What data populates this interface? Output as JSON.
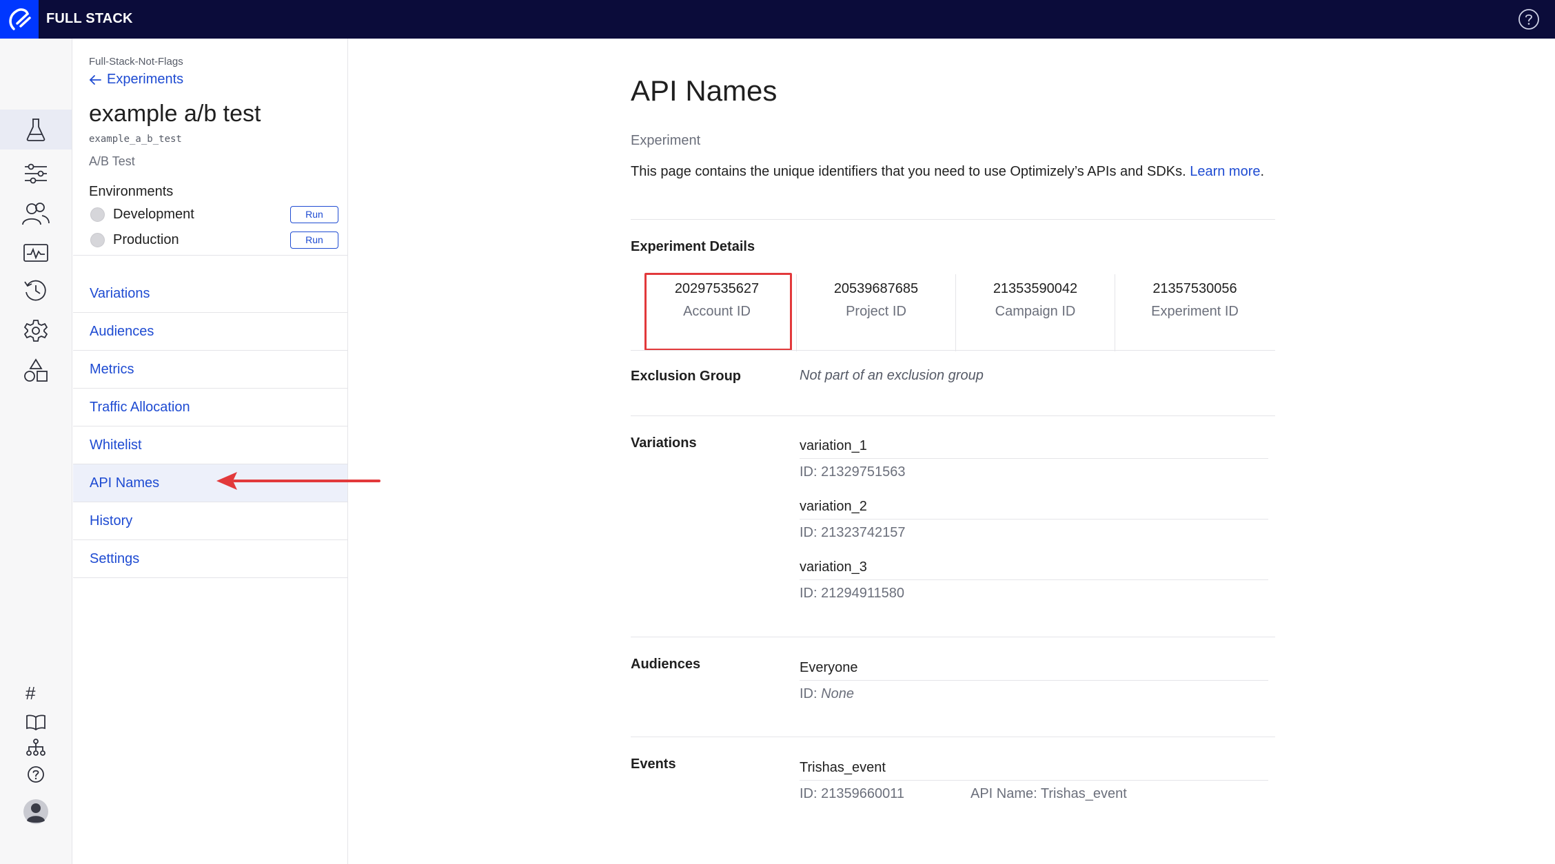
{
  "app": {
    "title": "FULL STACK"
  },
  "sidebar": {
    "project": "Full-Stack-Not-Flags",
    "back_label": "Experiments",
    "experiment_name": "example a/b test",
    "experiment_key": "example_a_b_test",
    "experiment_type": "A/B Test",
    "environments_heading": "Environments",
    "environments": [
      {
        "name": "Development",
        "action": "Run"
      },
      {
        "name": "Production",
        "action": "Run"
      }
    ],
    "nav": [
      {
        "label": "Variations"
      },
      {
        "label": "Audiences"
      },
      {
        "label": "Metrics"
      },
      {
        "label": "Traffic Allocation"
      },
      {
        "label": "Whitelist"
      },
      {
        "label": "API Names",
        "active": true
      },
      {
        "label": "History"
      },
      {
        "label": "Settings"
      }
    ]
  },
  "main": {
    "title": "API Names",
    "eyebrow": "Experiment",
    "description": "This page contains the unique identifiers that you need to use Optimizely’s APIs and SDKs.",
    "learn_more": "Learn more",
    "details_heading": "Experiment Details",
    "ids": [
      {
        "value": "20297535627",
        "label": "Account ID"
      },
      {
        "value": "20539687685",
        "label": "Project ID"
      },
      {
        "value": "21353590042",
        "label": "Campaign ID"
      },
      {
        "value": "21357530056",
        "label": "Experiment ID"
      }
    ],
    "exclusion_group": {
      "label": "Exclusion Group",
      "value": "Not part of an exclusion group"
    },
    "variations": {
      "label": "Variations",
      "items": [
        {
          "name": "variation_1",
          "id": "ID: 21329751563"
        },
        {
          "name": "variation_2",
          "id": "ID: 21323742157"
        },
        {
          "name": "variation_3",
          "id": "ID: 21294911580"
        }
      ]
    },
    "audiences": {
      "label": "Audiences",
      "items": [
        {
          "name": "Everyone",
          "id_prefix": "ID: ",
          "id_value": "None"
        }
      ]
    },
    "events": {
      "label": "Events",
      "items": [
        {
          "name": "Trishas_event",
          "id": "ID: 21359660011",
          "api_name": "API Name: Trishas_event"
        }
      ]
    }
  },
  "colors": {
    "topbar": "#0b0c3a",
    "brand": "#0037ff",
    "link": "#1e4bd2",
    "annotation": "#e2393b"
  },
  "icons": {
    "rail": [
      "flags-icon",
      "experiments-icon",
      "settings-sliders-icon",
      "audiences-icon",
      "reports-icon",
      "history-icon",
      "gear-icon",
      "shapes-icon"
    ],
    "rail_bottom": [
      "hash-icon",
      "book-icon",
      "hierarchy-icon",
      "help-icon",
      "avatar"
    ]
  }
}
